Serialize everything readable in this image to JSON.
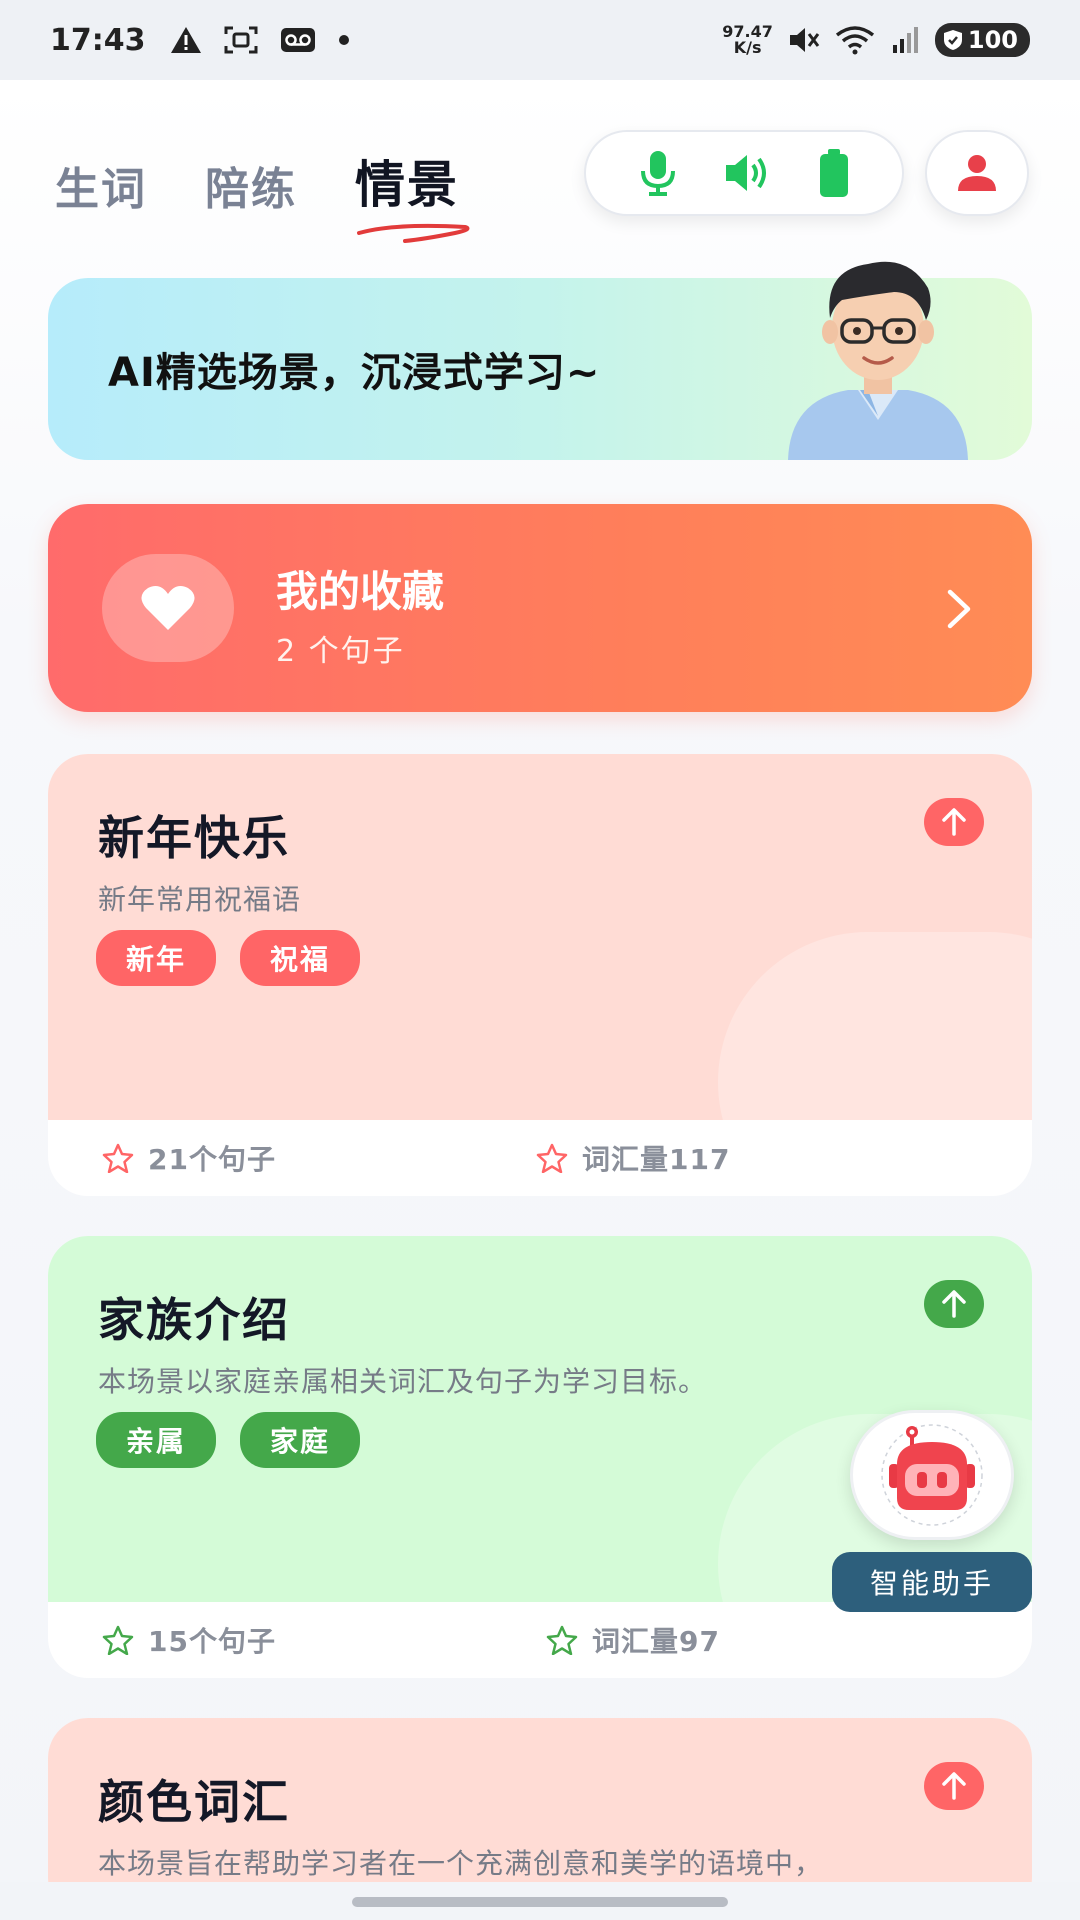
{
  "status_bar": {
    "time": "17:43",
    "net_speed_value": "97.47",
    "net_speed_unit": "K/s",
    "battery": "100",
    "icons": [
      "warning-icon",
      "screenshot-icon",
      "voicemail-icon",
      "dot-icon",
      "mute-icon",
      "wifi-icon",
      "signal-icon",
      "battery-icon"
    ]
  },
  "tabs": [
    {
      "label": "生词",
      "active": false
    },
    {
      "label": "陪练",
      "active": false
    },
    {
      "label": "情景",
      "active": true
    }
  ],
  "controls": {
    "icons": [
      "microphone-icon",
      "speaker-icon",
      "battery-full-icon"
    ],
    "accent": "#22c55e"
  },
  "banner": {
    "text": "AI精选场景，沉浸式学习~"
  },
  "favorites": {
    "title": "我的收藏",
    "count_text": "2 个句子"
  },
  "scenes": [
    {
      "title": "新年快乐",
      "desc": "新年常用祝福语",
      "tags": [
        "新年",
        "祝福"
      ],
      "sentences": "21个句子",
      "vocab": "词汇量117",
      "theme": "#ff6566",
      "bg": "#ffdcd5"
    },
    {
      "title": "家族介绍",
      "desc": "本场景以家庭亲属相关词汇及句子为学习目标。",
      "tags": [
        "亲属",
        "家庭"
      ],
      "sentences": "15个句子",
      "vocab": "词汇量97",
      "theme": "#44a84a",
      "bg": "#d4fbd7"
    },
    {
      "title": "颜色词汇",
      "desc": "本场景旨在帮助学习者在一个充满创意和美学的语境中，",
      "tags": [],
      "sentences": "",
      "vocab": "",
      "theme": "#ff6566",
      "bg": "#ffdcd5"
    }
  ],
  "assistant": {
    "label": "智能助手"
  }
}
